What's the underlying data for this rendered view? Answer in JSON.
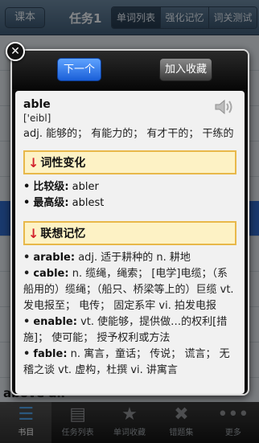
{
  "header": {
    "back_label": "课本",
    "title": "任务1",
    "tabs": [
      "单词列表",
      "强化记忆",
      "词关测试"
    ]
  },
  "background": {
    "partial_text": "above all"
  },
  "popup": {
    "next_label": "下一个",
    "favorite_label": "加入收藏",
    "word": "able",
    "phonetic": "['eibl]",
    "definition": "adj. 能够的； 有能力的； 有才干的； 干练的",
    "forms_section": "词性变化",
    "forms": [
      {
        "label": "比较级:",
        "value": "abler"
      },
      {
        "label": "最高级:",
        "value": "ablest"
      }
    ],
    "assoc_section": "联想记忆",
    "assoc": [
      {
        "word": "arable:",
        "text": "adj. 适于耕种的 n. 耕地"
      },
      {
        "word": "cable:",
        "text": "n. 缆绳，绳索； [电学]电缆；（系船用的）缆绳；（船只、桥梁等上的）巨缆 vt. 发电报至； 电传； 固定系牢 vi. 拍发电报"
      },
      {
        "word": "enable:",
        "text": "vt. 使能够，提供做…的权利[措施]； 使可能； 授予权利或方法"
      },
      {
        "word": "fable:",
        "text": "n. 寓言，童话； 传说； 谎言； 无稽之谈 vt. 虚构，杜撰 vi. 讲寓言"
      }
    ]
  },
  "tabbar": {
    "items": [
      {
        "label": "书目",
        "icon": "list-icon"
      },
      {
        "label": "任务列表",
        "icon": "clipboard-icon"
      },
      {
        "label": "单词收藏",
        "icon": "star-icon"
      },
      {
        "label": "错题集",
        "icon": "x-circle-icon"
      },
      {
        "label": "更多",
        "icon": "more-icon"
      }
    ]
  }
}
